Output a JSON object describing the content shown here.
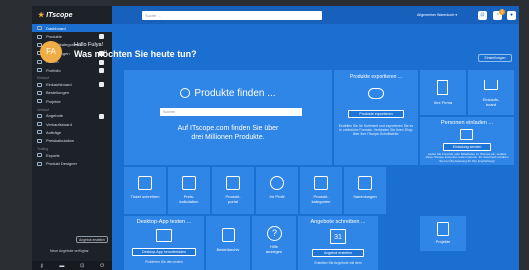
{
  "sidebar": {
    "logo_mark": "★",
    "logo": "ITscope",
    "items": [
      {
        "label": "Dashboard",
        "active": true
      },
      {
        "label": "Produkte",
        "plus": true
      },
      {
        "label": "Produktkategorien"
      },
      {
        "label": "Sammlungen",
        "plus": true
      },
      {
        "label": "Firmen",
        "plus": true
      },
      {
        "label": "Portfolio",
        "plus": true
      }
    ],
    "section_einkauf": "Einkauf",
    "einkauf_items": [
      {
        "label": "Einkaufsboard",
        "plus": true
      },
      {
        "label": "Bestellungen"
      },
      {
        "label": "Projekte"
      }
    ],
    "section_verkauf": "Verkauf",
    "verkauf_items": [
      {
        "label": "Angebote",
        "plus": true
      },
      {
        "label": "Verkaufsboard"
      },
      {
        "label": "Aufträge"
      },
      {
        "label": "Preiskalkulation"
      }
    ],
    "section_tools": "Tooling",
    "tools_items": [
      {
        "label": "Exporte"
      },
      {
        "label": "Produkt Designer"
      }
    ],
    "create_offer_button": "Angebot erstellen",
    "tip": "Neue Angebote verfügbar"
  },
  "topbar": {
    "search_placeholder": "Suche ...",
    "std_warenkorb": "Allgemeiner Warenkorb ▾",
    "badge_count": "1"
  },
  "header": {
    "avatar": "FA",
    "greeting": "Hallo Fulya!",
    "question": "Was möchten Sie heute tun?",
    "settings_button": "Einstellungen"
  },
  "products_tile": {
    "title": "Produkte finden ...",
    "search_placeholder": "Suchen",
    "subtitle_line1": "Auf ITscope.com finden Sie über",
    "subtitle_line2": "drei Millionen Produkte."
  },
  "export_tile": {
    "title": "Produkte exportieren ...",
    "button": "Produkte exportieren",
    "desc": "Erstellen Sie Ihr Sortiment und exportieren Sie es in zahlreiche Formate. Verbinden Sie Ihren Shop über Ihre ITscope-Schnittstelle."
  },
  "company_tile": {
    "label": "Ihre Firma"
  },
  "cart_tile": {
    "label": "Einkaufs-\nboard"
  },
  "invite_tile": {
    "title": "Personen einladen ...",
    "button": "Einladung senden",
    "desc": "Laden Sie Freunde oder Mitarbeiter zu ITscope ein, sodass diese ITscope kostenlos testen können. Ihr Geschenk erhalten Sie bei Überweisung für Ihre Empfehlung!"
  },
  "small_tiles": [
    {
      "label": "Ticket schreiben"
    },
    {
      "label": "Preis-\nkalkulation"
    },
    {
      "label": "Produkt-\nportal"
    },
    {
      "label": "Ihr Profil"
    },
    {
      "label": "Produkt-\nkategorien"
    },
    {
      "label": "Sammlungen"
    }
  ],
  "desktop_tile": {
    "title": "Desktop-App testen ...",
    "button": "Desktop-App herunterladen",
    "desc": "Probieren Sie den ersten"
  },
  "archive_tile": {
    "label": "Bestellarchiv"
  },
  "help_tile": {
    "label": "Hilfe\nanzeigen"
  },
  "offers_tile": {
    "title": "Angebote schreiben ...",
    "calendar_day": "31",
    "button": "Angebot erstellen",
    "desc": "Erstellen Sie Angebote mit dem"
  },
  "projects_tile": {
    "label": "Projekte"
  },
  "colors": {
    "brand": "#1b6fd1",
    "tile": "#2f86e6",
    "sidebar": "#1d2228",
    "accent": "#f0ad45"
  }
}
